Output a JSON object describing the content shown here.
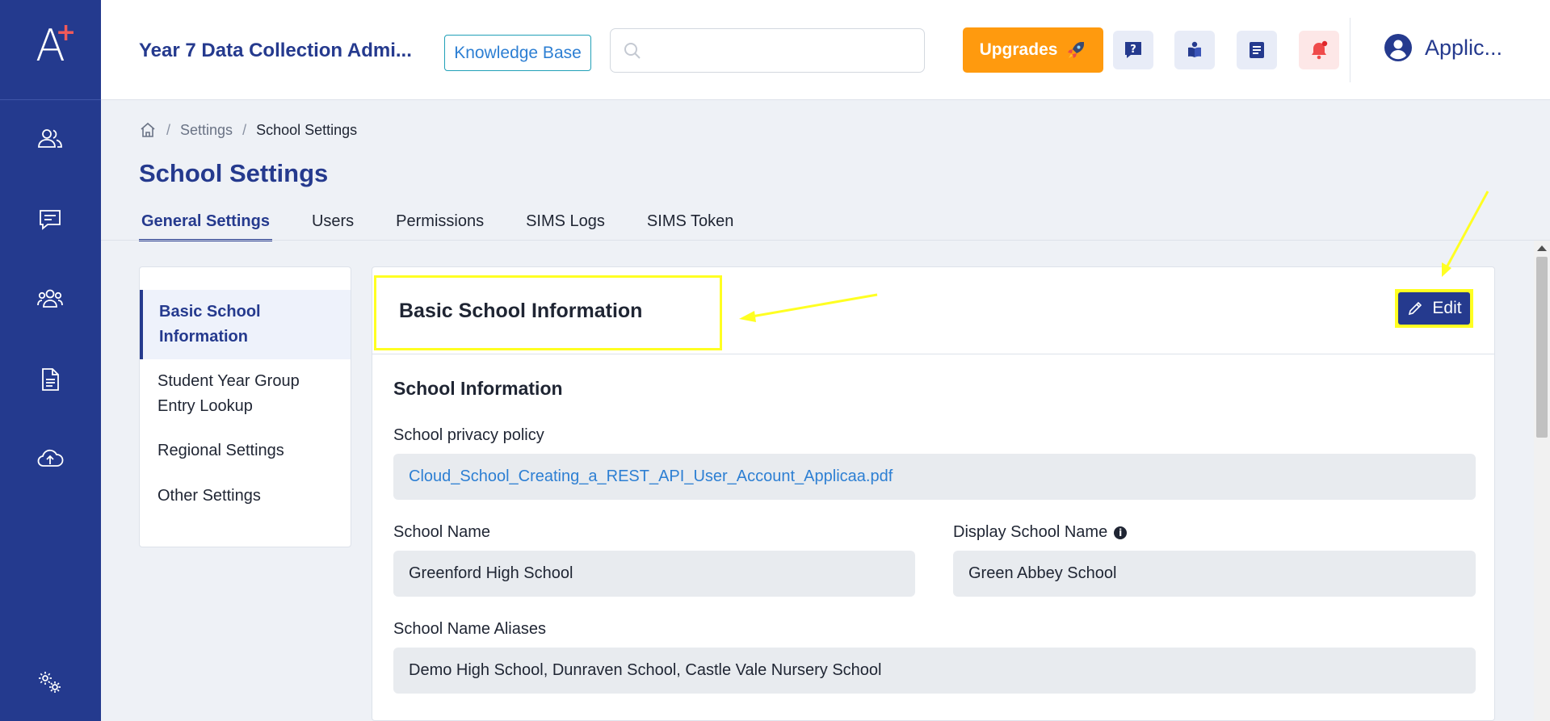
{
  "sidebar": {
    "logo_letter": "A",
    "logo_plus": "+",
    "icons": [
      "users-icon",
      "message-icon",
      "group-icon",
      "document-icon",
      "cloud-upload-icon",
      "settings-gears-icon"
    ]
  },
  "header": {
    "app_title": "Year 7 Data Collection Admi...",
    "knowledge_base": "Knowledge Base",
    "search_placeholder": "",
    "upgrades": "Upgrades",
    "user_name": "Applic..."
  },
  "breadcrumb": {
    "settings": "Settings",
    "current": "School Settings"
  },
  "page_title": "School Settings",
  "tabs": [
    {
      "label": "General Settings",
      "active": true
    },
    {
      "label": "Users",
      "active": false
    },
    {
      "label": "Permissions",
      "active": false
    },
    {
      "label": "SIMS Logs",
      "active": false
    },
    {
      "label": "SIMS Token",
      "active": false
    }
  ],
  "submenu": [
    {
      "label": "Basic School Information",
      "active": true
    },
    {
      "label": "Student Year Group Entry Lookup",
      "active": false
    },
    {
      "label": "Regional Settings",
      "active": false
    },
    {
      "label": "Other Settings",
      "active": false
    }
  ],
  "card": {
    "title": "Basic School Information",
    "edit_label": "Edit",
    "section_title": "School Information",
    "privacy_label": "School privacy policy",
    "privacy_value": "Cloud_School_Creating_a_REST_API_User_Account_Applicaa.pdf",
    "school_name_label": "School Name",
    "school_name_value": "Greenford High School",
    "display_name_label": "Display School Name",
    "display_name_value": "Green Abbey School",
    "aliases_label": "School Name Aliases",
    "aliases_value": "Demo High School, Dunraven School, Castle Vale Nursery School",
    "info_icon_glyph": "i"
  },
  "colors": {
    "sidebar": "#243a8e",
    "accent": "#253a8e",
    "upgrade": "#ff9a0e",
    "highlight": "#ffff22"
  }
}
